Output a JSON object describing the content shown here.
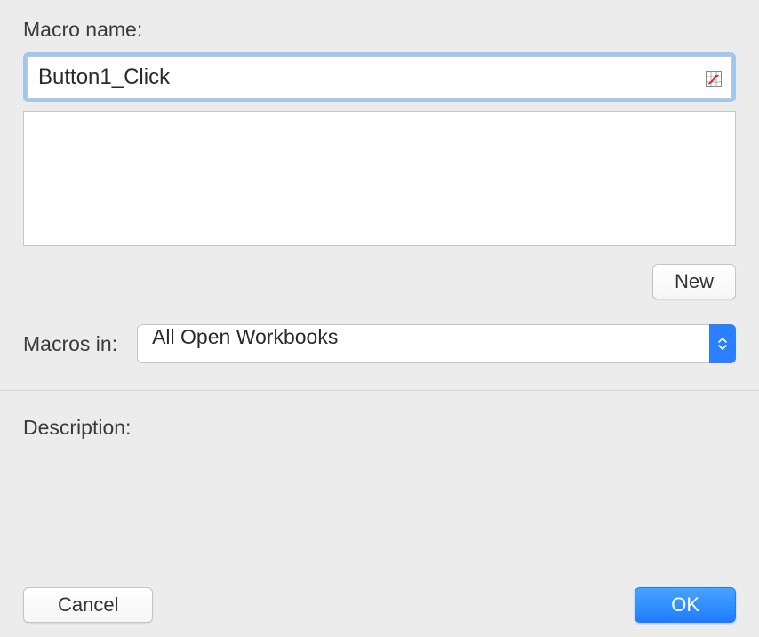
{
  "labels": {
    "macro_name": "Macro name:",
    "macros_in": "Macros in:",
    "description": "Description:"
  },
  "macro_name_value": "Button1_Click",
  "macros_in_value": "All Open Workbooks",
  "buttons": {
    "new": "New",
    "cancel": "Cancel",
    "ok": "OK"
  }
}
